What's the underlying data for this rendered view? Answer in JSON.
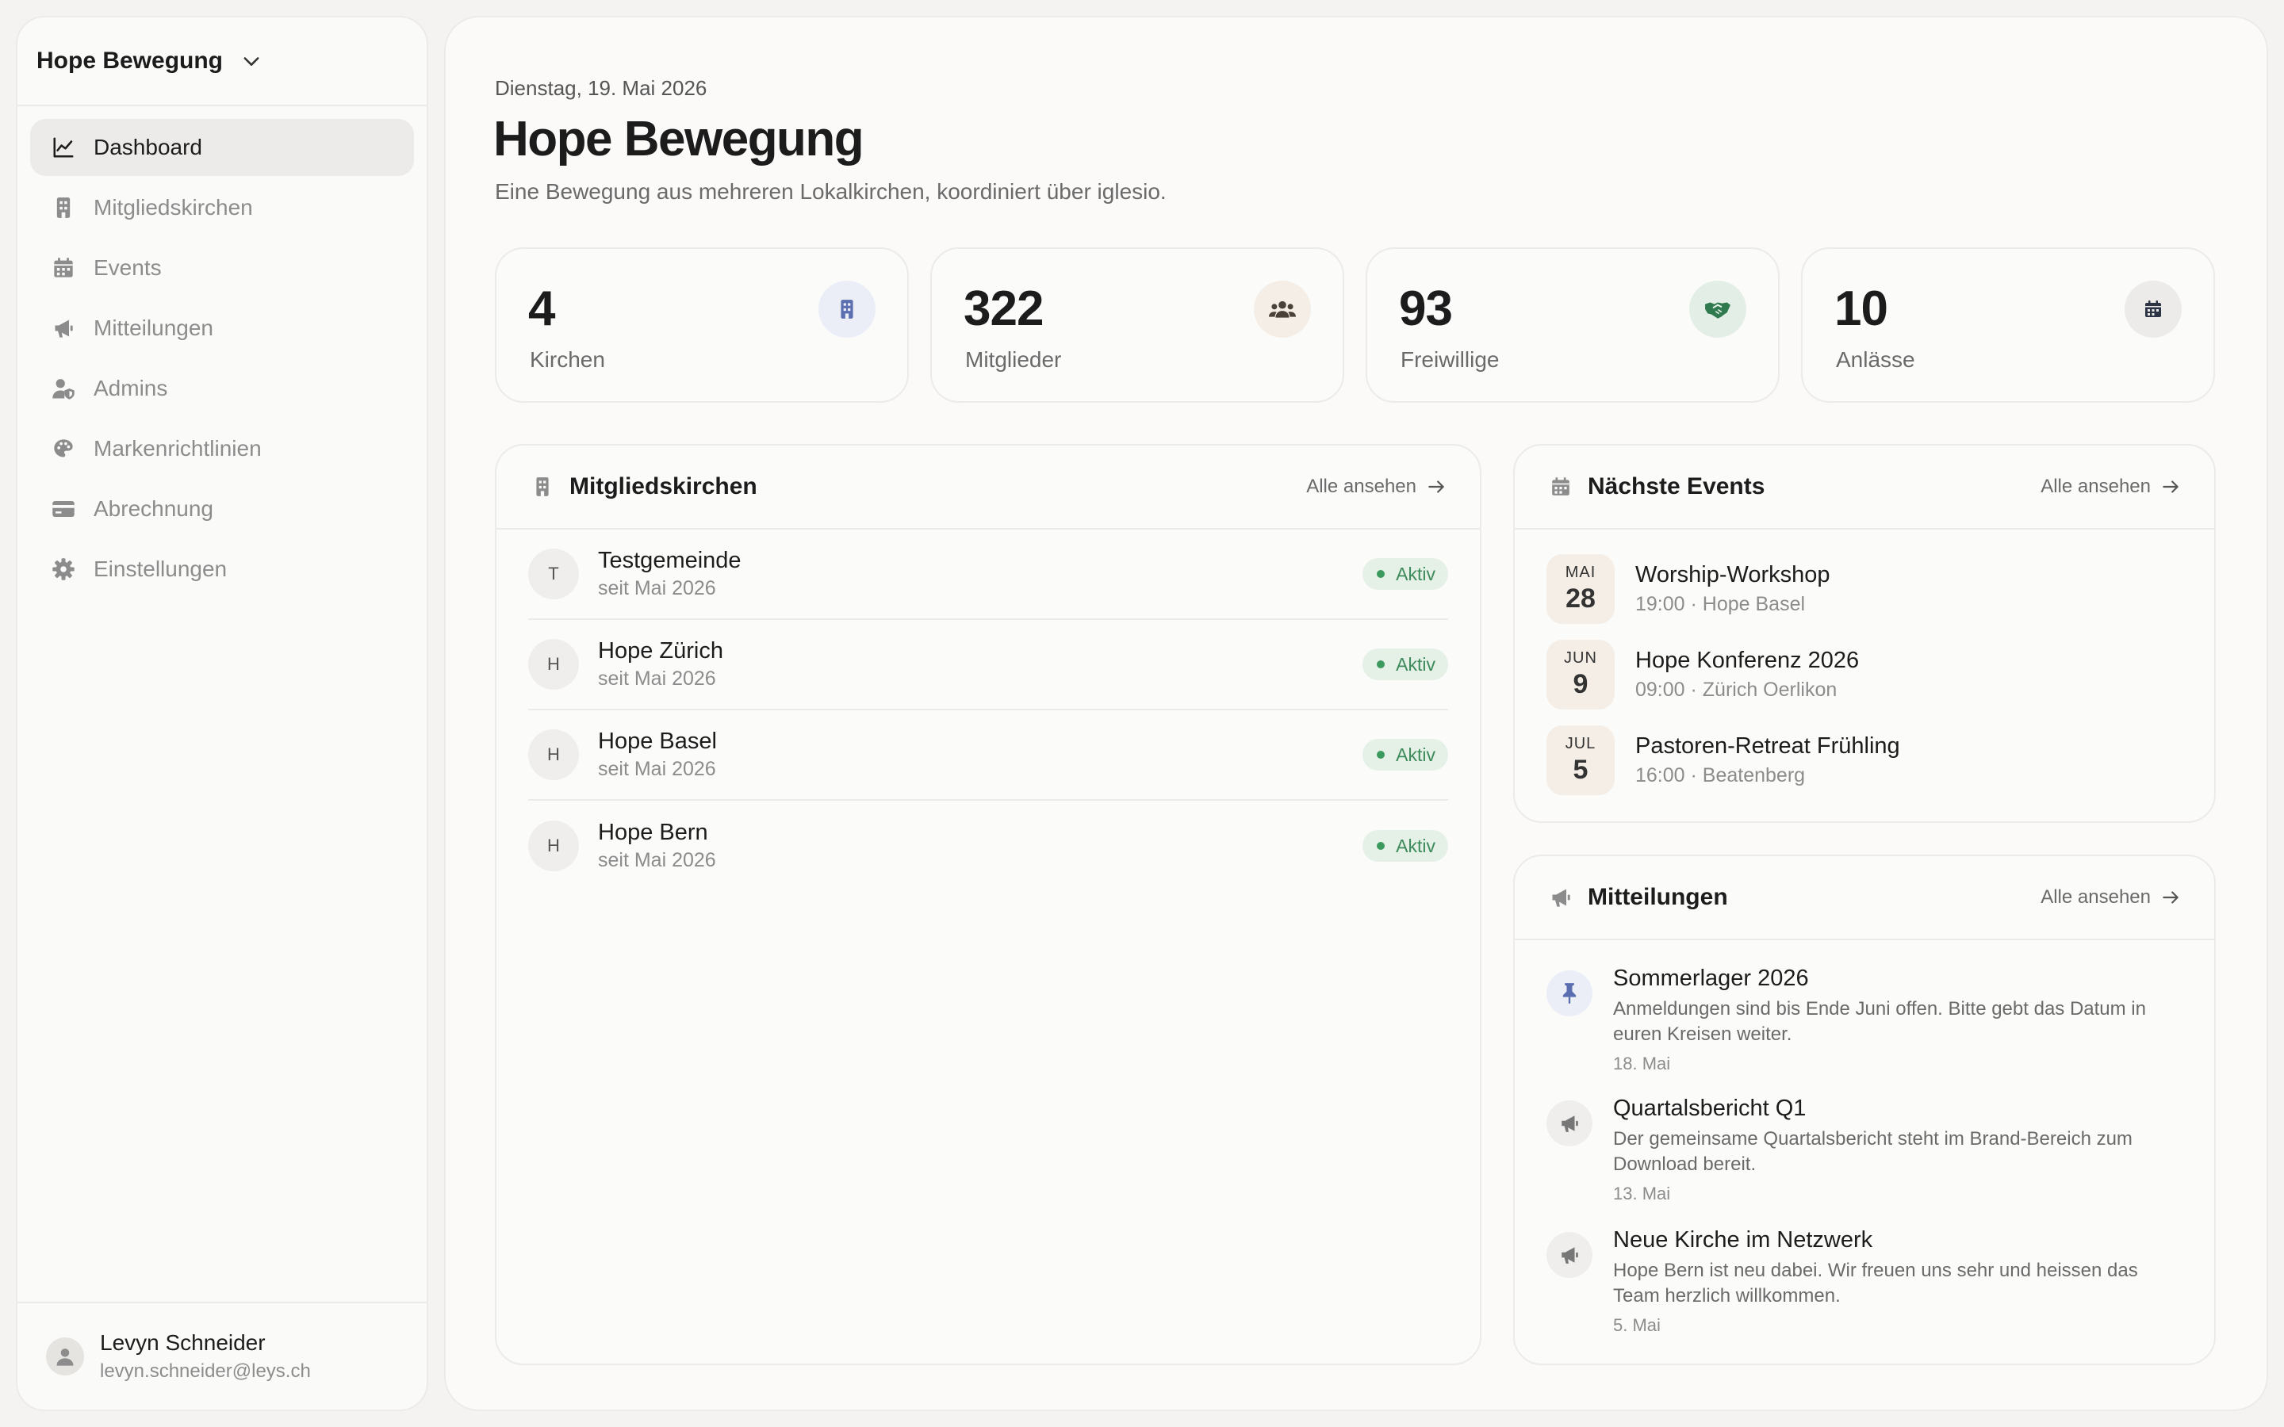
{
  "sidebar": {
    "org_name": "Hope Bewegung",
    "nav": [
      {
        "label": "Dashboard",
        "icon": "chart-line-icon"
      },
      {
        "label": "Mitgliedskirchen",
        "icon": "building-icon"
      },
      {
        "label": "Events",
        "icon": "calendar-icon"
      },
      {
        "label": "Mitteilungen",
        "icon": "megaphone-icon"
      },
      {
        "label": "Admins",
        "icon": "user-shield-icon"
      },
      {
        "label": "Markenrichtlinien",
        "icon": "palette-icon"
      },
      {
        "label": "Abrechnung",
        "icon": "credit-card-icon"
      },
      {
        "label": "Einstellungen",
        "icon": "gear-icon"
      }
    ],
    "user": {
      "name": "Levyn Schneider",
      "email": "levyn.schneider@leys.ch"
    }
  },
  "header": {
    "date": "Dienstag, 19. Mai 2026",
    "title": "Hope Bewegung",
    "subtitle": "Eine Bewegung aus mehreren Lokalkirchen, koordiniert über iglesio."
  },
  "stats": [
    {
      "value": "4",
      "label": "Kirchen",
      "icon": "building-icon",
      "color": "#eceef7",
      "icon_color": "#5b6fb0"
    },
    {
      "value": "322",
      "label": "Mitglieder",
      "icon": "users-icon",
      "color": "#f4eee6",
      "icon_color": "#4a4238"
    },
    {
      "value": "93",
      "label": "Freiwillige",
      "icon": "handshake-icon",
      "color": "#e3efe6",
      "icon_color": "#2f7a4e"
    },
    {
      "value": "10",
      "label": "Anlässe",
      "icon": "calendar-icon",
      "color": "#ecebe9",
      "icon_color": "#2c3445"
    }
  ],
  "churches": {
    "title": "Mitgliedskirchen",
    "link": "Alle ansehen",
    "items": [
      {
        "initial": "T",
        "name": "Testgemeinde",
        "since": "seit Mai 2026",
        "status": "Aktiv"
      },
      {
        "initial": "H",
        "name": "Hope Zürich",
        "since": "seit Mai 2026",
        "status": "Aktiv"
      },
      {
        "initial": "H",
        "name": "Hope Basel",
        "since": "seit Mai 2026",
        "status": "Aktiv"
      },
      {
        "initial": "H",
        "name": "Hope Bern",
        "since": "seit Mai 2026",
        "status": "Aktiv"
      }
    ]
  },
  "events": {
    "title": "Nächste Events",
    "link": "Alle ansehen",
    "items": [
      {
        "month": "MAI",
        "day": "28",
        "name": "Worship-Workshop",
        "detail": "19:00 · Hope Basel"
      },
      {
        "month": "JUN",
        "day": "9",
        "name": "Hope Konferenz 2026",
        "detail": "09:00 · Zürich Oerlikon"
      },
      {
        "month": "JUL",
        "day": "5",
        "name": "Pastoren-Retreat Frühling",
        "detail": "16:00 · Beatenberg"
      }
    ]
  },
  "messages": {
    "title": "Mitteilungen",
    "link": "Alle ansehen",
    "items": [
      {
        "icon": "pin-icon",
        "title": "Sommerlager 2026",
        "body": "Anmeldungen sind bis Ende Juni offen. Bitte gebt das Datum in euren Kreisen weiter.",
        "date": "18. Mai"
      },
      {
        "icon": "megaphone-icon",
        "title": "Quartalsbericht Q1",
        "body": "Der gemeinsame Quartalsbericht steht im Brand-Bereich zum Download bereit.",
        "date": "13. Mai"
      },
      {
        "icon": "megaphone-icon",
        "title": "Neue Kirche im Netzwerk",
        "body": "Hope Bern ist neu dabei. Wir freuen uns sehr und heissen das Team herzlich willkommen.",
        "date": "5. Mai"
      }
    ]
  }
}
